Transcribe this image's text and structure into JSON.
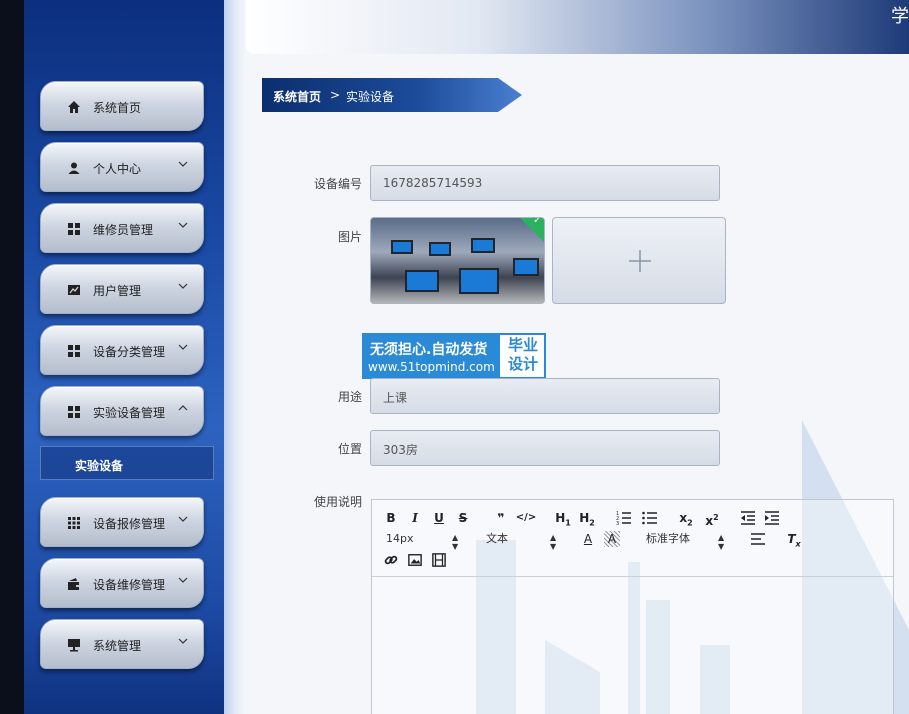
{
  "app": {
    "header_title": "学"
  },
  "sidebar": {
    "items": [
      {
        "label": "系统首页",
        "icon": "home-icon",
        "has_chevron": false
      },
      {
        "label": "个人中心",
        "icon": "user-icon",
        "has_chevron": true
      },
      {
        "label": "维修员管理",
        "icon": "grid-icon",
        "has_chevron": true
      },
      {
        "label": "用户管理",
        "icon": "chart-icon",
        "has_chevron": true
      },
      {
        "label": "设备分类管理",
        "icon": "grid-icon",
        "has_chevron": true
      },
      {
        "label": "实验设备管理",
        "icon": "grid-icon",
        "has_chevron": true,
        "expanded": true
      },
      {
        "label": "设备报修管理",
        "icon": "apps-icon",
        "has_chevron": true
      },
      {
        "label": "设备维修管理",
        "icon": "wallet-icon",
        "has_chevron": true
      },
      {
        "label": "系统管理",
        "icon": "monitor-icon",
        "has_chevron": true
      }
    ],
    "submenu_active": "实验设备"
  },
  "breadcrumb": {
    "home": "系统首页",
    "separator": ">",
    "current": "实验设备"
  },
  "form": {
    "device_no": {
      "label": "设备编号",
      "value": "1678285714593"
    },
    "image": {
      "label": "图片",
      "upload_icon": "plus-icon"
    },
    "usage": {
      "label": "用途",
      "value": "上课"
    },
    "location": {
      "label": "位置",
      "value": "303房"
    },
    "instructions": {
      "label": "使用说明"
    }
  },
  "watermark": {
    "line1": "无须担心.自动发货",
    "line2": "www.51topmind.com",
    "right": "毕业设计"
  },
  "editor": {
    "buttons_row1": [
      "B",
      "I",
      "U",
      "S",
      "❞",
      "</>",
      "H1",
      "H2",
      "ol",
      "ul",
      "x₂",
      "x²",
      "outdent",
      "indent"
    ],
    "font_size": "14px",
    "text_type": "文本",
    "font_family": "标准字体"
  },
  "colors": {
    "sidebar": "#1b4ba6",
    "breadcrumb": "#0c2e6e",
    "watermark": "#2a8ad6"
  }
}
